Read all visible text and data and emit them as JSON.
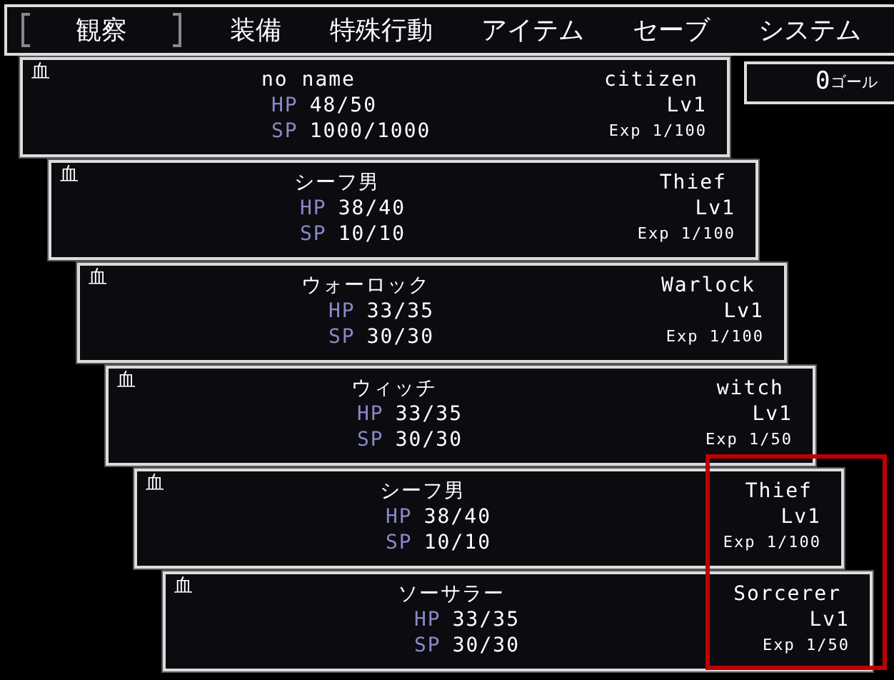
{
  "menu": [
    {
      "label": "観察",
      "selected": true
    },
    {
      "label": "装備",
      "selected": false
    },
    {
      "label": "特殊行動",
      "selected": false
    },
    {
      "label": "アイテム",
      "selected": false
    },
    {
      "label": "セーブ",
      "selected": false
    },
    {
      "label": "システム",
      "selected": false
    }
  ],
  "gold": {
    "amount": "0",
    "unit": "ゴール"
  },
  "party": [
    {
      "mark": "血",
      "name": "no name",
      "class": "citizen",
      "hp_label": "HP",
      "hp": "48/50",
      "sp_label": "SP",
      "sp": "1000/1000",
      "level": "Lv1",
      "exp": "Exp 1/100"
    },
    {
      "mark": "血",
      "name": "シーフ男",
      "class": "Thief",
      "hp_label": "HP",
      "hp": "38/40",
      "sp_label": "SP",
      "sp": "10/10",
      "level": "Lv1",
      "exp": "Exp 1/100"
    },
    {
      "mark": "血",
      "name": "ウォーロック",
      "class": "Warlock",
      "hp_label": "HP",
      "hp": "33/35",
      "sp_label": "SP",
      "sp": "30/30",
      "level": "Lv1",
      "exp": "Exp 1/100"
    },
    {
      "mark": "血",
      "name": "ウィッチ",
      "class": "witch",
      "hp_label": "HP",
      "hp": "33/35",
      "sp_label": "SP",
      "sp": "30/30",
      "level": "Lv1",
      "exp": "Exp 1/50"
    },
    {
      "mark": "血",
      "name": "シーフ男",
      "class": "Thief",
      "hp_label": "HP",
      "hp": "38/40",
      "sp_label": "SP",
      "sp": "10/10",
      "level": "Lv1",
      "exp": "Exp 1/100"
    },
    {
      "mark": "血",
      "name": "ソーサラー",
      "class": "Sorcerer",
      "hp_label": "HP",
      "hp": "33/35",
      "sp_label": "SP",
      "sp": "30/30",
      "level": "Lv1",
      "exp": "Exp 1/50"
    }
  ]
}
